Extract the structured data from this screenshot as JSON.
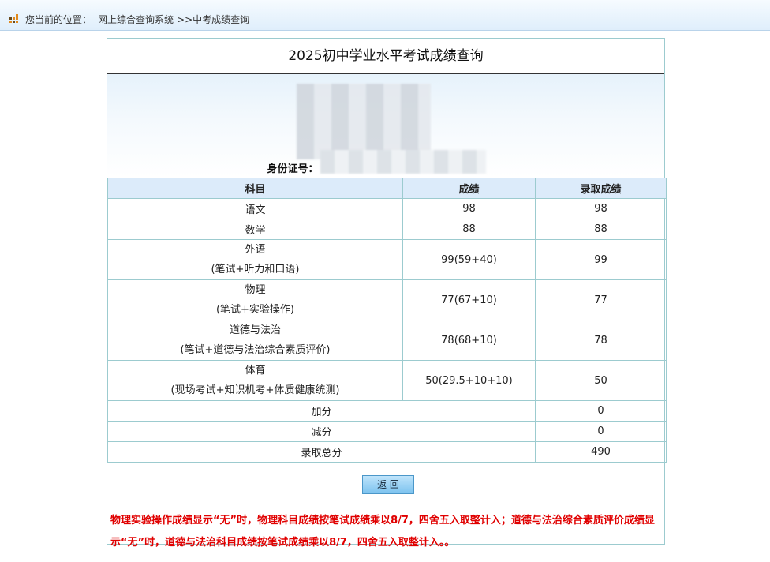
{
  "breadcrumb": {
    "prefix": "您当前的位置：",
    "item1": "网上综合查询系统",
    "item2": ">>中考成绩查询"
  },
  "title": "2025初中学业水平考试成绩查询",
  "info": {
    "id_label": "身份证号："
  },
  "table": {
    "headers": [
      "科目",
      "成绩",
      "录取成绩"
    ],
    "rows": [
      {
        "subject": "语文",
        "detail": "",
        "score": "98",
        "admit": "98"
      },
      {
        "subject": "数学",
        "detail": "",
        "score": "88",
        "admit": "88"
      },
      {
        "subject": "外语",
        "detail": "(笔试+听力和口语)",
        "score": "99(59+40)",
        "admit": "99"
      },
      {
        "subject": "物理",
        "detail": "(笔试+实验操作)",
        "score": "77(67+10)",
        "admit": "77"
      },
      {
        "subject": "道德与法治",
        "detail": "(笔试+道德与法治综合素质评价)",
        "score": "78(68+10)",
        "admit": "78"
      },
      {
        "subject": "体育",
        "detail": "(现场考试+知识机考+体质健康统测)",
        "score": "50(29.5+10+10)",
        "admit": "50"
      }
    ],
    "bonus_label": "加分",
    "bonus": "0",
    "deduct_label": "减分",
    "deduct": "0",
    "total_label": "录取总分",
    "total": "490"
  },
  "back_label": "返 回",
  "note": "物理实验操作成绩显示“无”时，物理科目成绩按笔试成绩乘以8/7，四舍五入取整计入；道德与法治综合素质评价成绩显示“无”时，道德与法治科目成绩按笔试成绩乘以8/7，四舍五入取整计入。。"
}
